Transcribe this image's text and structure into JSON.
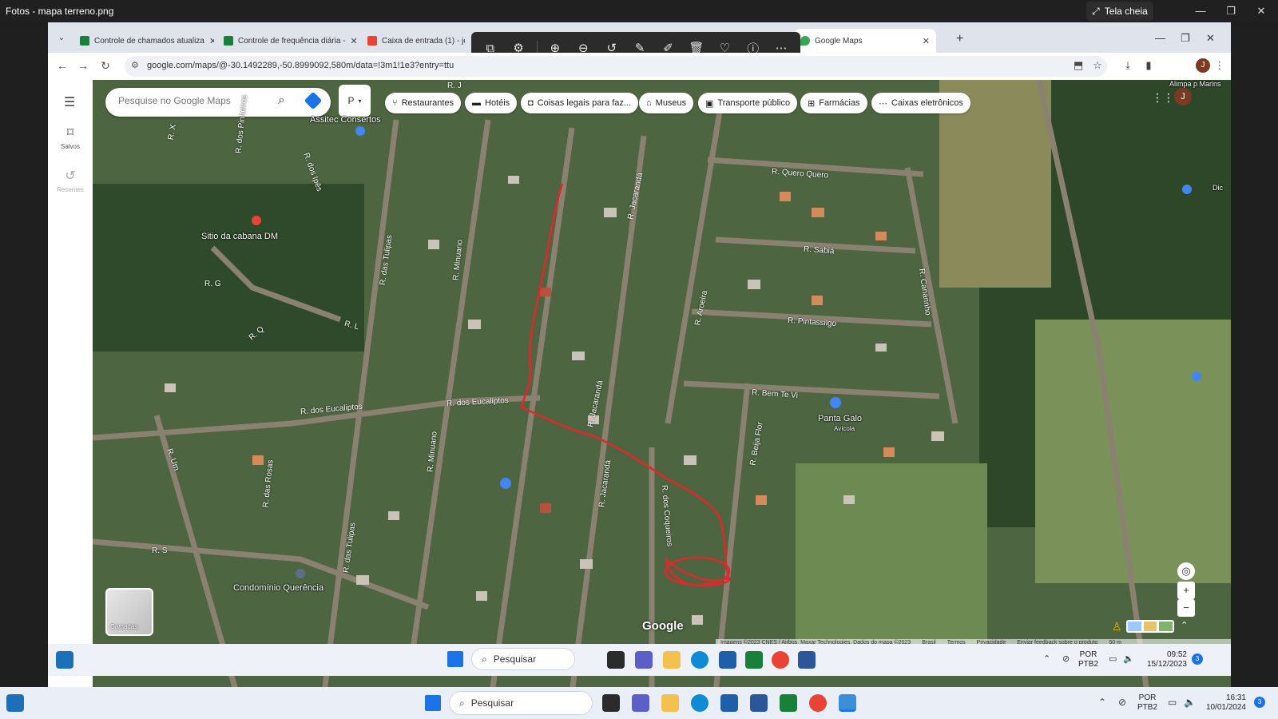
{
  "photos_app": {
    "title": "Fotos - mapa terreno.png",
    "fullscreen_label": "Tela cheia"
  },
  "browser": {
    "tabs": [
      {
        "label": "Controle de chamados atualiza",
        "favicon_color": "#188038"
      },
      {
        "label": "Controle de frequência diária -",
        "favicon_color": "#188038"
      },
      {
        "label": "Caixa de entrada (1) - jose",
        "favicon_color": "#ea4335"
      },
      {
        "label": "Google Maps",
        "favicon_color": "#34a853"
      }
    ],
    "url": "google.com/maps/@-30.1492289,-50.8999092,580m/data=!3m1!1e3?entry=ttu"
  },
  "maps": {
    "search_placeholder": "Pesquise no Google Maps",
    "mode_chip": "P",
    "chips": [
      "Restaurantes",
      "Hotéis",
      "Coisas legais para faz...",
      "Museus",
      "Transporte público",
      "Farmácias",
      "Caixas eletrônicos"
    ],
    "sidebar": [
      {
        "label": "Salvos"
      },
      {
        "label": "Recentes"
      }
    ],
    "layers_label": "Camadas",
    "places": {
      "assistec": "Assitec Consertos",
      "sitio": "Sitio da cabana DM",
      "panta_galo": "Panta Galo",
      "panta_galo_sub": "Avícola",
      "condominio": "Condomínio Querência",
      "top_right": "Alimpa p Marins",
      "right_edge": "Dic"
    },
    "streets": {
      "querero": "R. Quero Quero",
      "sabia": "R. Sabiá",
      "pintassilgo": "R. Pintassilgo",
      "bem_te_vi": "R. Bem Te Vi",
      "eucaliptos": "R. dos Eucaliptos",
      "jacaranda": "R. Jacarandá",
      "jacaranda2": "R. Jacarandá",
      "minuano": "R. Minuano",
      "minuano2": "R. Minuano",
      "tulipas": "R. das Tulipas",
      "tulipas2": "R. das Tulipas",
      "rosas": "R. das Rosas",
      "coqueiros": "R. dos Coqueiros",
      "aroeira": "R. Aroeira",
      "beija_flor": "R. Beija Flor",
      "canarinho": "R. Canarinho",
      "ipes": "R. dos Ipês",
      "rl": "R. L",
      "rg": "R. G",
      "rq": "R. Q",
      "rs": "R. S",
      "rx": "R. X",
      "rj": "R. J",
      "r_um": "R. Um",
      "r_pinheiros": "R. dos Pinheiros"
    },
    "google": "Google",
    "attribution": [
      "Imagens ©2023 CNES / Airbus, Maxar Technologies, Dados do mapa ©2023",
      "Brasil",
      "Termos",
      "Privacidade",
      "Enviar feedback sobre o produto",
      "50 m"
    ]
  },
  "inner_taskbar": {
    "search": "Pesquisar",
    "lang": "POR",
    "lang2": "PTB2",
    "time": "09:52",
    "date": "15/12/2023",
    "badge": "3"
  },
  "taskbar": {
    "search": "Pesquisar",
    "lang": "POR",
    "lang2": "PTB2",
    "time": "16:31",
    "date": "10/01/2024",
    "badge": "3"
  },
  "colors": {
    "route_red": "#e3262a",
    "accent_blue": "#1a73e8"
  }
}
